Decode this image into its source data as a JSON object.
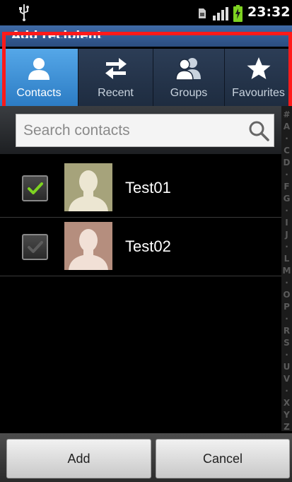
{
  "status_bar": {
    "time": "23:32",
    "icons": [
      "usb-icon",
      "sim-icon",
      "signal-icon",
      "battery-charging-icon"
    ]
  },
  "title": "Add recipient",
  "tabs": [
    {
      "label": "Contacts",
      "icon": "person-icon",
      "selected": true
    },
    {
      "label": "Recent",
      "icon": "swap-arrows-icon",
      "selected": false
    },
    {
      "label": "Groups",
      "icon": "group-icon",
      "selected": false
    },
    {
      "label": "Favourites",
      "icon": "star-icon",
      "selected": false
    }
  ],
  "search": {
    "placeholder": "Search contacts",
    "value": ""
  },
  "index_letters": [
    "#",
    "A",
    "·",
    "C",
    "D",
    "·",
    "F",
    "G",
    "·",
    "I",
    "J",
    "·",
    "L",
    "M",
    "·",
    "O",
    "P",
    "·",
    "R",
    "S",
    "·",
    "U",
    "V",
    "·",
    "X",
    "Y",
    "Z"
  ],
  "contacts": [
    {
      "name": "Test01",
      "checked": true,
      "avatar_color": "#a6a37b"
    },
    {
      "name": "Test02",
      "checked": false,
      "avatar_color": "#b58e7e"
    }
  ],
  "buttons": {
    "add": "Add",
    "cancel": "Cancel"
  },
  "colors": {
    "tab_selected": "#3a92d8",
    "check_green": "#7ed321",
    "highlight_box": "#ff1a1a"
  }
}
